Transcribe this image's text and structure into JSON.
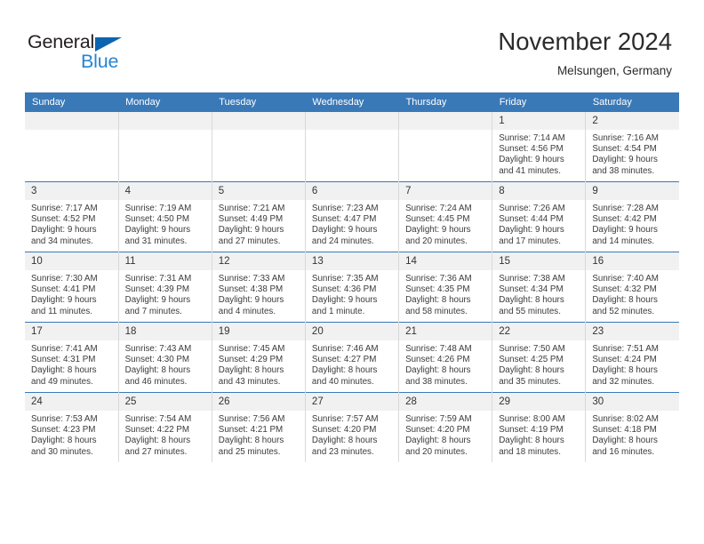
{
  "brand": {
    "name_part1": "General",
    "name_part2": "Blue",
    "triangle_color": "#0c64b0",
    "blue_color": "#2585d3",
    "dark_color": "#231f20"
  },
  "header": {
    "month_title": "November 2024",
    "location": "Melsungen, Germany"
  },
  "theme": {
    "header_row_bg": "#3a79b8",
    "daynum_bg": "#f1f1f1",
    "cell_border": "#d9d9d9",
    "week_separator": "#3a79b8"
  },
  "weekdays": [
    "Sunday",
    "Monday",
    "Tuesday",
    "Wednesday",
    "Thursday",
    "Friday",
    "Saturday"
  ],
  "weeks": [
    [
      {
        "day": "",
        "empty": true
      },
      {
        "day": "",
        "empty": true
      },
      {
        "day": "",
        "empty": true
      },
      {
        "day": "",
        "empty": true
      },
      {
        "day": "",
        "empty": true
      },
      {
        "day": "1",
        "sunrise": "Sunrise: 7:14 AM",
        "sunset": "Sunset: 4:56 PM",
        "daylight1": "Daylight: 9 hours",
        "daylight2": "and 41 minutes."
      },
      {
        "day": "2",
        "sunrise": "Sunrise: 7:16 AM",
        "sunset": "Sunset: 4:54 PM",
        "daylight1": "Daylight: 9 hours",
        "daylight2": "and 38 minutes."
      }
    ],
    [
      {
        "day": "3",
        "sunrise": "Sunrise: 7:17 AM",
        "sunset": "Sunset: 4:52 PM",
        "daylight1": "Daylight: 9 hours",
        "daylight2": "and 34 minutes."
      },
      {
        "day": "4",
        "sunrise": "Sunrise: 7:19 AM",
        "sunset": "Sunset: 4:50 PM",
        "daylight1": "Daylight: 9 hours",
        "daylight2": "and 31 minutes."
      },
      {
        "day": "5",
        "sunrise": "Sunrise: 7:21 AM",
        "sunset": "Sunset: 4:49 PM",
        "daylight1": "Daylight: 9 hours",
        "daylight2": "and 27 minutes."
      },
      {
        "day": "6",
        "sunrise": "Sunrise: 7:23 AM",
        "sunset": "Sunset: 4:47 PM",
        "daylight1": "Daylight: 9 hours",
        "daylight2": "and 24 minutes."
      },
      {
        "day": "7",
        "sunrise": "Sunrise: 7:24 AM",
        "sunset": "Sunset: 4:45 PM",
        "daylight1": "Daylight: 9 hours",
        "daylight2": "and 20 minutes."
      },
      {
        "day": "8",
        "sunrise": "Sunrise: 7:26 AM",
        "sunset": "Sunset: 4:44 PM",
        "daylight1": "Daylight: 9 hours",
        "daylight2": "and 17 minutes."
      },
      {
        "day": "9",
        "sunrise": "Sunrise: 7:28 AM",
        "sunset": "Sunset: 4:42 PM",
        "daylight1": "Daylight: 9 hours",
        "daylight2": "and 14 minutes."
      }
    ],
    [
      {
        "day": "10",
        "sunrise": "Sunrise: 7:30 AM",
        "sunset": "Sunset: 4:41 PM",
        "daylight1": "Daylight: 9 hours",
        "daylight2": "and 11 minutes."
      },
      {
        "day": "11",
        "sunrise": "Sunrise: 7:31 AM",
        "sunset": "Sunset: 4:39 PM",
        "daylight1": "Daylight: 9 hours",
        "daylight2": "and 7 minutes."
      },
      {
        "day": "12",
        "sunrise": "Sunrise: 7:33 AM",
        "sunset": "Sunset: 4:38 PM",
        "daylight1": "Daylight: 9 hours",
        "daylight2": "and 4 minutes."
      },
      {
        "day": "13",
        "sunrise": "Sunrise: 7:35 AM",
        "sunset": "Sunset: 4:36 PM",
        "daylight1": "Daylight: 9 hours",
        "daylight2": "and 1 minute."
      },
      {
        "day": "14",
        "sunrise": "Sunrise: 7:36 AM",
        "sunset": "Sunset: 4:35 PM",
        "daylight1": "Daylight: 8 hours",
        "daylight2": "and 58 minutes."
      },
      {
        "day": "15",
        "sunrise": "Sunrise: 7:38 AM",
        "sunset": "Sunset: 4:34 PM",
        "daylight1": "Daylight: 8 hours",
        "daylight2": "and 55 minutes."
      },
      {
        "day": "16",
        "sunrise": "Sunrise: 7:40 AM",
        "sunset": "Sunset: 4:32 PM",
        "daylight1": "Daylight: 8 hours",
        "daylight2": "and 52 minutes."
      }
    ],
    [
      {
        "day": "17",
        "sunrise": "Sunrise: 7:41 AM",
        "sunset": "Sunset: 4:31 PM",
        "daylight1": "Daylight: 8 hours",
        "daylight2": "and 49 minutes."
      },
      {
        "day": "18",
        "sunrise": "Sunrise: 7:43 AM",
        "sunset": "Sunset: 4:30 PM",
        "daylight1": "Daylight: 8 hours",
        "daylight2": "and 46 minutes."
      },
      {
        "day": "19",
        "sunrise": "Sunrise: 7:45 AM",
        "sunset": "Sunset: 4:29 PM",
        "daylight1": "Daylight: 8 hours",
        "daylight2": "and 43 minutes."
      },
      {
        "day": "20",
        "sunrise": "Sunrise: 7:46 AM",
        "sunset": "Sunset: 4:27 PM",
        "daylight1": "Daylight: 8 hours",
        "daylight2": "and 40 minutes."
      },
      {
        "day": "21",
        "sunrise": "Sunrise: 7:48 AM",
        "sunset": "Sunset: 4:26 PM",
        "daylight1": "Daylight: 8 hours",
        "daylight2": "and 38 minutes."
      },
      {
        "day": "22",
        "sunrise": "Sunrise: 7:50 AM",
        "sunset": "Sunset: 4:25 PM",
        "daylight1": "Daylight: 8 hours",
        "daylight2": "and 35 minutes."
      },
      {
        "day": "23",
        "sunrise": "Sunrise: 7:51 AM",
        "sunset": "Sunset: 4:24 PM",
        "daylight1": "Daylight: 8 hours",
        "daylight2": "and 32 minutes."
      }
    ],
    [
      {
        "day": "24",
        "sunrise": "Sunrise: 7:53 AM",
        "sunset": "Sunset: 4:23 PM",
        "daylight1": "Daylight: 8 hours",
        "daylight2": "and 30 minutes."
      },
      {
        "day": "25",
        "sunrise": "Sunrise: 7:54 AM",
        "sunset": "Sunset: 4:22 PM",
        "daylight1": "Daylight: 8 hours",
        "daylight2": "and 27 minutes."
      },
      {
        "day": "26",
        "sunrise": "Sunrise: 7:56 AM",
        "sunset": "Sunset: 4:21 PM",
        "daylight1": "Daylight: 8 hours",
        "daylight2": "and 25 minutes."
      },
      {
        "day": "27",
        "sunrise": "Sunrise: 7:57 AM",
        "sunset": "Sunset: 4:20 PM",
        "daylight1": "Daylight: 8 hours",
        "daylight2": "and 23 minutes."
      },
      {
        "day": "28",
        "sunrise": "Sunrise: 7:59 AM",
        "sunset": "Sunset: 4:20 PM",
        "daylight1": "Daylight: 8 hours",
        "daylight2": "and 20 minutes."
      },
      {
        "day": "29",
        "sunrise": "Sunrise: 8:00 AM",
        "sunset": "Sunset: 4:19 PM",
        "daylight1": "Daylight: 8 hours",
        "daylight2": "and 18 minutes."
      },
      {
        "day": "30",
        "sunrise": "Sunrise: 8:02 AM",
        "sunset": "Sunset: 4:18 PM",
        "daylight1": "Daylight: 8 hours",
        "daylight2": "and 16 minutes."
      }
    ]
  ]
}
